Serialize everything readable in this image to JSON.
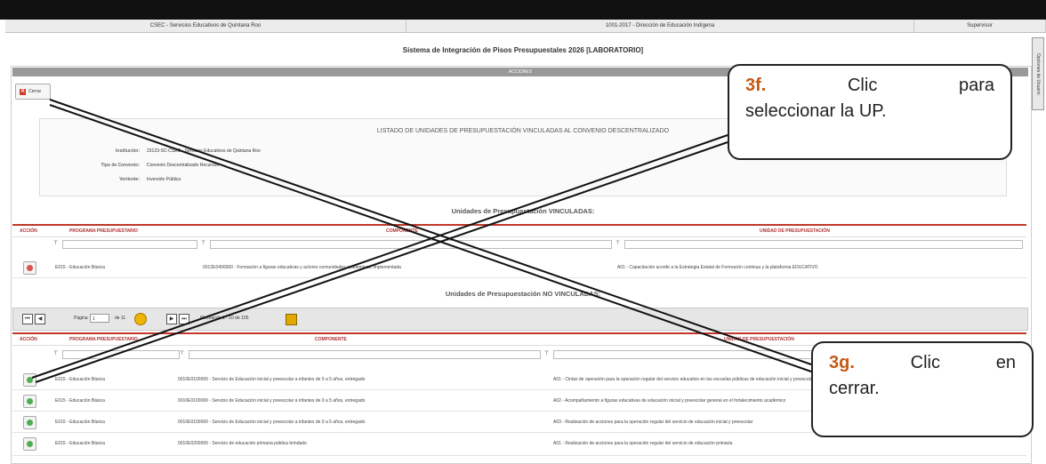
{
  "header": {
    "col1": "CSEC - Servicios Educativos de Quintana Roo",
    "col2": "1001-2017 - Dirección de Educación Indígena",
    "col3": "Supervisor"
  },
  "side_tab": "Opciones de Usuario",
  "app_title": "Sistema de Integración de Pisos Presupuestales 2026 [LABORATORIO]",
  "acciones": {
    "head": "ACCIONES",
    "cerrar_label": "Cerrar"
  },
  "listado": {
    "title": "LISTADO DE UNIDADES DE PRESUPUESTACIÓN VINCULADAS AL CONVENIO DESCENTRALIZADO",
    "rows": [
      {
        "label": "Institución:",
        "value": "23123-SC-CSEC - Servicios Educativos de Quintana Roo"
      },
      {
        "label": "Tipo de Convenio:",
        "value": "Convenio Descentralizado Recursos"
      },
      {
        "label": "Vertiente:",
        "value": "Inversión Pública"
      }
    ]
  },
  "vinculadas": {
    "title": "Unidades de Presupuestación VINCULADAS:",
    "headers": {
      "accion": "ACCIÓN",
      "programa": "PROGRAMA PRESUPUESTARIO",
      "componente": "COMPONENTE",
      "unidad": "UNIDAD DE PRESUPUESTACIÓN"
    },
    "rows": [
      {
        "programa": "E015 - Educación Básica",
        "componente": "0012E0400000 - Formación a figuras educativas y actores comunidades académicas, implementada",
        "unidad": "A01 - Capacitación acorde a la Estrategia Estatal de Formación continua y la plataforma EDUCATIVO"
      }
    ]
  },
  "no_vinculadas": {
    "title": "Unidades de Presupuestación NO VINCULADAS:",
    "pager": {
      "page_label": "Página",
      "page_value": "1",
      "of_label": "de 11",
      "summary": "Mostrando 1 - 10 de 105"
    },
    "headers": {
      "accion": "ACCIÓN",
      "programa": "PROGRAMA PRESUPUESTARIO",
      "componente": "COMPONENTE",
      "unidad": "UNIDAD DE PRESUPUESTACIÓN"
    },
    "rows": [
      {
        "programa": "E015 - Educación Básica",
        "componente": "0010E0100000 - Servicio de Educación inicial y preescolar a infantes de 0 a 5 años, entregado",
        "unidad": "A01 - Cintas de operación para la operación regular del servicio educativo en las escuelas públicas de educación inicial y preescolar"
      },
      {
        "programa": "E015 - Educación Básica",
        "componente": "0010E0100000 - Servicio de Educación inicial y preescolar a infantes de 0 a 5 años, entregado",
        "unidad": "A02 - Acompañamiento a figuras educativas de educación inicial y preescolar general en el fortalecimiento académico"
      },
      {
        "programa": "E015 - Educación Básica",
        "componente": "0010E0100000 - Servicio de Educación inicial y preescolar a infantes de 0 a 5 años, entregado",
        "unidad": "A03 - Realización de acciones para la operación regular del servicio de educación inicial y preescolar"
      },
      {
        "programa": "E015 - Educación Básica",
        "componente": "0010E0200000 - Servicio de educación primaria pública brindado",
        "unidad": "A01 - Realización de acciones para la operación regular del servicio de educación primaria"
      }
    ]
  },
  "callouts": {
    "c1": {
      "num": "3f.",
      "text1": "Clic",
      "text2": "para",
      "text3": "seleccionar la UP."
    },
    "c2": {
      "num": "3g.",
      "text1": "Clic",
      "text2": "en",
      "text3": "cerrar."
    }
  },
  "colors": {
    "accent_red": "#c0392b",
    "callout_num": "#c55a11",
    "add_green": "#4caf50",
    "remove_red": "#d9534f"
  }
}
